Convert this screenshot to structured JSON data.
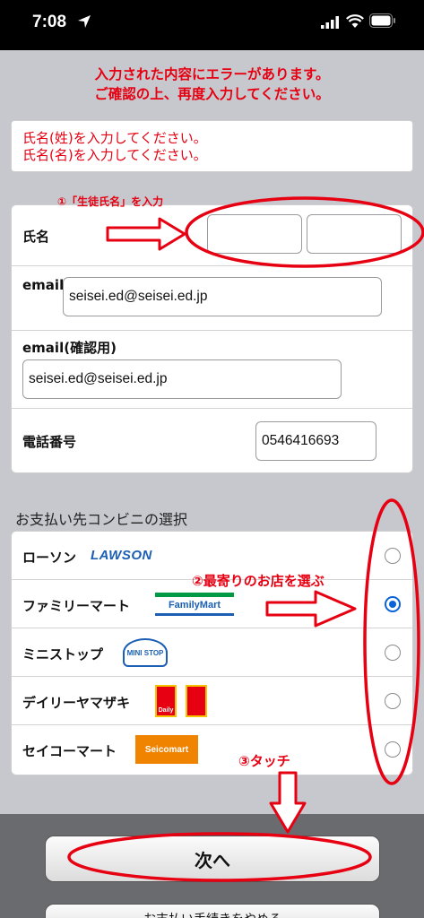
{
  "status_bar": {
    "time": "7:08"
  },
  "error_header": {
    "line1": "入力された内容にエラーがあります。",
    "line2": "ご確認の上、再度入力してください。"
  },
  "error_box": {
    "line1": "氏名(姓)を入力してください。",
    "line2": "氏名(名)を入力してください。"
  },
  "form": {
    "name_label": "氏名",
    "last_name_value": "",
    "first_name_value": "",
    "email_label": "email",
    "email_value": "seisei.ed@seisei.ed.jp",
    "email_confirm_label": "email(確認用)",
    "email_confirm_value": "seisei.ed@seisei.ed.jp",
    "phone_label": "電話番号",
    "phone_value": "0546416693"
  },
  "convenience": {
    "section_title": "お支払い先コンビニの選択",
    "stores": [
      {
        "label": "ローソン",
        "logo_text": "LAWSON",
        "selected": false
      },
      {
        "label": "ファミリーマート",
        "logo_text": "FamilyMart",
        "selected": true
      },
      {
        "label": "ミニストップ",
        "logo_text": "MINI STOP",
        "selected": false
      },
      {
        "label": "デイリーヤマザキ",
        "logo_text": "Daily",
        "selected": false
      },
      {
        "label": "セイコーマート",
        "logo_text": "Seicomart",
        "selected": false
      }
    ]
  },
  "buttons": {
    "next_label": "次へ",
    "second_label": "お支払い手続きをやめる"
  },
  "annotations": {
    "step1": "①「生徒氏名」を入力",
    "step2": "②最寄りのお店を選ぶ",
    "step3": "③タッチ"
  },
  "colors": {
    "error_red": "#e60012",
    "radio_blue": "#0b63d9",
    "lawson_blue": "#1b5fb4",
    "familymart_green": "#009a44"
  }
}
